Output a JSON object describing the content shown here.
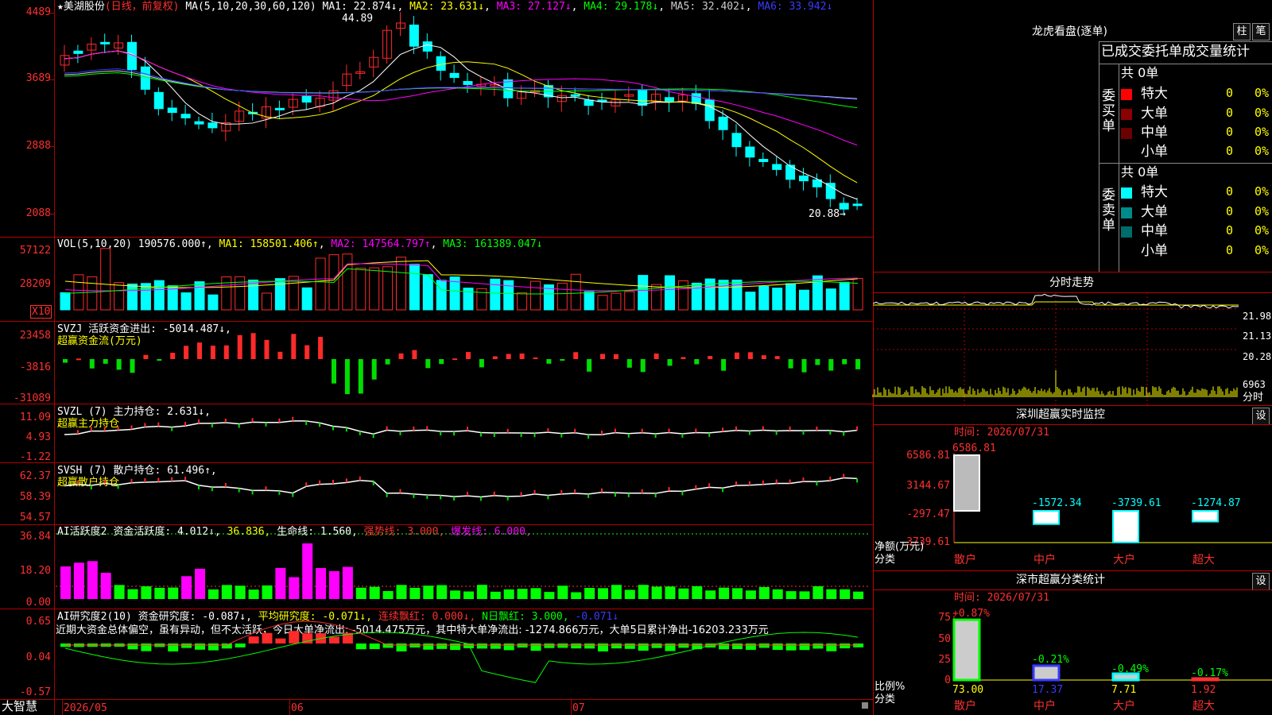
{
  "stock": {
    "star": "★",
    "name": "美湖股份",
    "period_label": "(日线，前复权)",
    "ma_header": "MA(5,10,20,30,60,120)",
    "ma_values": [
      "MA1: 22.874↓",
      "MA2: 23.631↓",
      "MA3: 27.127↓",
      "MA4: 29.178↓",
      "MA5: 32.402↓",
      "MA6: 33.942↓"
    ],
    "high_marker": "44.89",
    "low_marker": "20.88",
    "y_ticks": [
      "4489",
      "3689",
      "2888",
      "2088"
    ]
  },
  "vol": {
    "header": "VOL(5,10,20)",
    "value": "190576.000↑",
    "ma_values": [
      "MA1: 158501.406↑",
      "MA2: 147564.797↑",
      "MA3: 161389.047↓"
    ],
    "y_ticks": [
      "57122",
      "28209"
    ],
    "unit": "X10"
  },
  "svzj": {
    "header": "SVZJ",
    "title": "活跃资金进出: -5014.487↓,",
    "subtitle": "超赢资金流(万元)",
    "y_ticks": [
      "23458",
      "-3816",
      "-31089"
    ]
  },
  "svzl": {
    "header": "SVZL (7)",
    "title": "主力持仓: 2.631↓,",
    "subtitle": "超赢主力持仓",
    "y_ticks": [
      "11.09",
      "4.93",
      "-1.22"
    ]
  },
  "svsh": {
    "header": "SVSH (7)",
    "title": "散户持仓: 61.496↑,",
    "subtitle": "超赢散户持仓",
    "y_ticks": [
      "62.37",
      "58.39",
      "54.57"
    ]
  },
  "ai_active": {
    "header": "AI活跃度2",
    "label": "资金活跃度: 4.012↓,",
    "v2": "36.836,",
    "life": "生命线: 1.560,",
    "strong": "强势线: 3.000,",
    "burst": "爆发线: 6.000,",
    "y_ticks": [
      "36.84",
      "18.20",
      "0.00"
    ]
  },
  "ai_research": {
    "header": "AI研究度2(10)",
    "label": "资金研究度: -0.087↓,",
    "avg": "平均研究度: -0.071↓,",
    "red": "连续飘红: 0.000↓,",
    "nred": "N日飘红: 3.000,",
    "last": "-0.071↓",
    "summary": "近期大资金总体偏空，虽有异动，但不太活跃，今日大单净流出: -5014.475万元，其中特大单净流出: -1274.866万元，大单5日累计净出-16203.233万元",
    "y_ticks": [
      "0.65",
      "0.04",
      "-0.57"
    ]
  },
  "bottom_axis": {
    "brand": "大智慧",
    "months": [
      "2026/05",
      "06",
      "07"
    ]
  },
  "dragon": {
    "title": "龙虎看盘(逐单)",
    "btn_left": "柱",
    "btn_right": "笔",
    "header": "已成交委托单成交量统计",
    "buy_side": "委买单",
    "sell_side": "委卖单",
    "buy_total": "共 0单",
    "sell_total": "共 0单",
    "buy_rows": [
      {
        "label": "特大",
        "count": "0",
        "pct": "0%",
        "color": "#ff0000"
      },
      {
        "label": "大单",
        "count": "0",
        "pct": "0%",
        "color": "#8b0000"
      },
      {
        "label": "中单",
        "count": "0",
        "pct": "0%",
        "color": "#6b0000"
      },
      {
        "label": "小单",
        "count": "0",
        "pct": "0%",
        "color": ""
      }
    ],
    "sell_rows": [
      {
        "label": "特大",
        "count": "0",
        "pct": "0%",
        "color": "#00ffff"
      },
      {
        "label": "大单",
        "count": "0",
        "pct": "0%",
        "color": "#008b8b"
      },
      {
        "label": "中单",
        "count": "0",
        "pct": "0%",
        "color": "#006b6b"
      },
      {
        "label": "小单",
        "count": "0",
        "pct": "0%",
        "color": ""
      }
    ]
  },
  "intraday": {
    "title": "分时走势",
    "y_ticks": [
      "21.98",
      "21.13",
      "20.28"
    ],
    "vol_tick": "6963",
    "vol_label": "分时"
  },
  "sz_monitor": {
    "title": "深圳超赢实时监控",
    "btn": "设",
    "time": "时间: 2026/07/31",
    "y_ticks": [
      "6586.81",
      "3144.67",
      "-297.47",
      "-3739.61"
    ],
    "unit1": "净额(万元)",
    "unit2": "分类",
    "categories": [
      "散户",
      "中户",
      "大户",
      "超大"
    ],
    "values": [
      6586.81,
      -1572.34,
      -3739.61,
      -1274.87
    ],
    "value_labels": [
      "6586.81",
      "-1572.34",
      "-3739.61",
      "-1274.87"
    ]
  },
  "sz_class": {
    "title": "深市超赢分类统计",
    "btn": "设",
    "time": "时间: 2026/07/31",
    "y_ticks": [
      "75",
      "50",
      "25",
      "0"
    ],
    "unit1": "比例%",
    "unit2": "分类",
    "categories": [
      "散户",
      "中户",
      "大户",
      "超大"
    ],
    "ratios": [
      73.0,
      17.37,
      7.71,
      1.92
    ],
    "ratio_labels": [
      "73.00",
      "17.37",
      "7.71",
      "1.92"
    ],
    "changes": [
      "+0.87%",
      "-0.21%",
      "-0.49%",
      "-0.17%"
    ]
  },
  "colors": {
    "up": "#ff2a2a",
    "down": "#00ffff",
    "grid": "#b00000",
    "ma1": "#ffffff",
    "ma2": "#ffff00",
    "ma3": "#ff00ff",
    "ma4": "#00ff00",
    "ma5": "#cccccc",
    "ma6": "#3a3aff"
  }
}
